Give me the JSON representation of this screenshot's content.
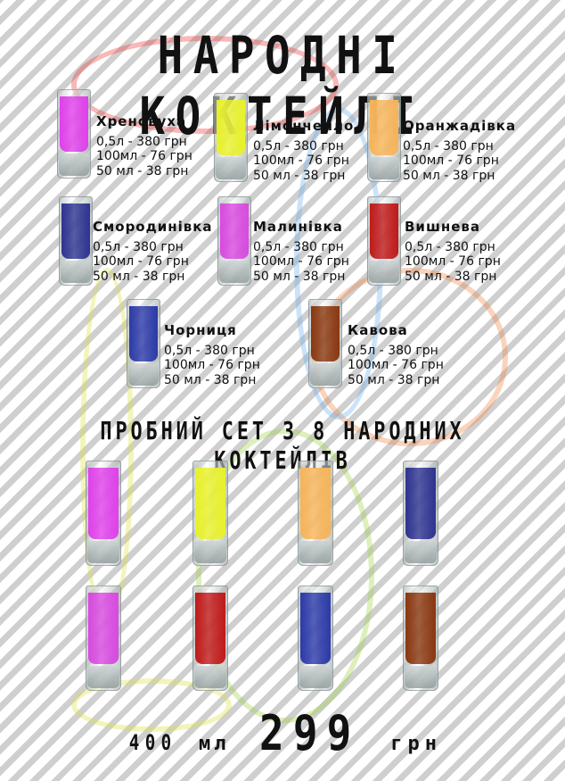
{
  "title": "НАРОДНІ КОКТЕЙЛІ",
  "items": [
    {
      "name": "Хреновуха",
      "p1": "0,5л - 380 грн",
      "p2": "100мл - 76 грн",
      "p3": "50 мл - 38 грн",
      "color": "#e040ea"
    },
    {
      "name": "Лімончелло",
      "p1": "0,5л - 380 грн",
      "p2": "100мл - 76 грн",
      "p3": "50 мл - 38 грн",
      "color": "#e9f22a"
    },
    {
      "name": "Оранжадівка",
      "p1": "0,5л - 380 грн",
      "p2": "100мл - 76 грн",
      "p3": "50 мл - 38 грн",
      "color": "#f7b458"
    },
    {
      "name": "Смородинівка",
      "p1": "0,5л - 380 грн",
      "p2": "100мл - 76 грн",
      "p3": "50 мл - 38 грн",
      "color": "#2e3490"
    },
    {
      "name": "Малинівка",
      "p1": "0,5л - 380 грн",
      "p2": "100мл - 76 грн",
      "p3": "50 мл - 38 грн",
      "color": "#d84ae0"
    },
    {
      "name": "Вишнева",
      "p1": "0,5л - 380 грн",
      "p2": "100мл - 76 грн",
      "p3": "50 мл - 38 грн",
      "color": "#c01a1a"
    },
    {
      "name": "Чорниця",
      "p1": "0,5л - 380 грн",
      "p2": "100мл - 76 грн",
      "p3": "50 мл - 38 грн",
      "color": "#2c3aa8"
    },
    {
      "name": "Кавова",
      "p1": "0,5л - 380 грн",
      "p2": "100мл - 76 грн",
      "p3": "50 мл - 38 грн",
      "color": "#8a3810"
    }
  ],
  "set": {
    "title": "ПРОБНИЙ СЕТ З 8 НАРОДНИХ КОКТЕЙЛІВ",
    "volume": "400",
    "volume_unit": "мл",
    "price": "299",
    "currency": "грн",
    "colors": [
      "#e040ea",
      "#e9f22a",
      "#f7b458",
      "#2e3490",
      "#d84ae0",
      "#c01a1a",
      "#2c3aa8",
      "#8a3810"
    ]
  }
}
